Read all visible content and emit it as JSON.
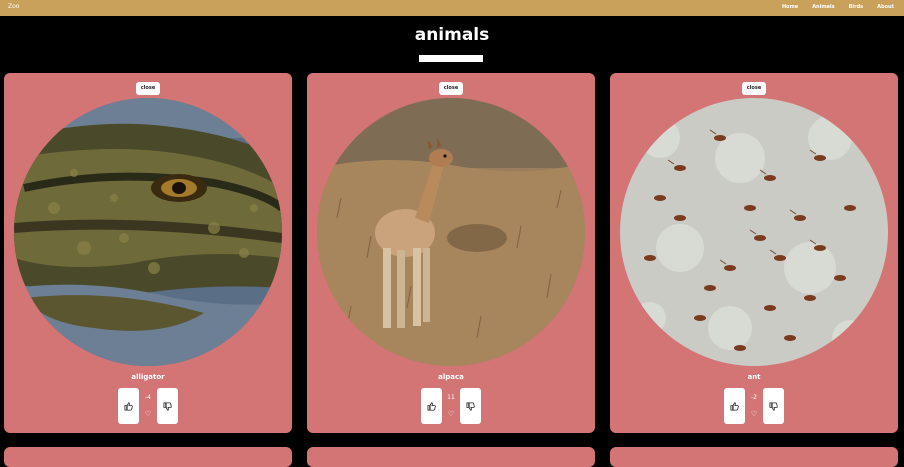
{
  "header": {
    "brand": "Zoo",
    "nav": [
      "Home",
      "Animals",
      "Birds",
      "About"
    ]
  },
  "page": {
    "title": "animals"
  },
  "cards": [
    {
      "name": "alligator",
      "score": "-4",
      "close_label": "close",
      "liked": false
    },
    {
      "name": "alpaca",
      "score": "11",
      "close_label": "close",
      "liked": false
    },
    {
      "name": "ant",
      "score": "-2",
      "close_label": "close",
      "liked": false
    }
  ],
  "icons": {
    "thumbs_up": "thumbs-up-icon",
    "thumbs_down": "thumbs-down-icon",
    "heart": "heart-icon"
  },
  "colors": {
    "topbar": "#c9a15b",
    "background": "#000000",
    "card": "#d37475"
  }
}
